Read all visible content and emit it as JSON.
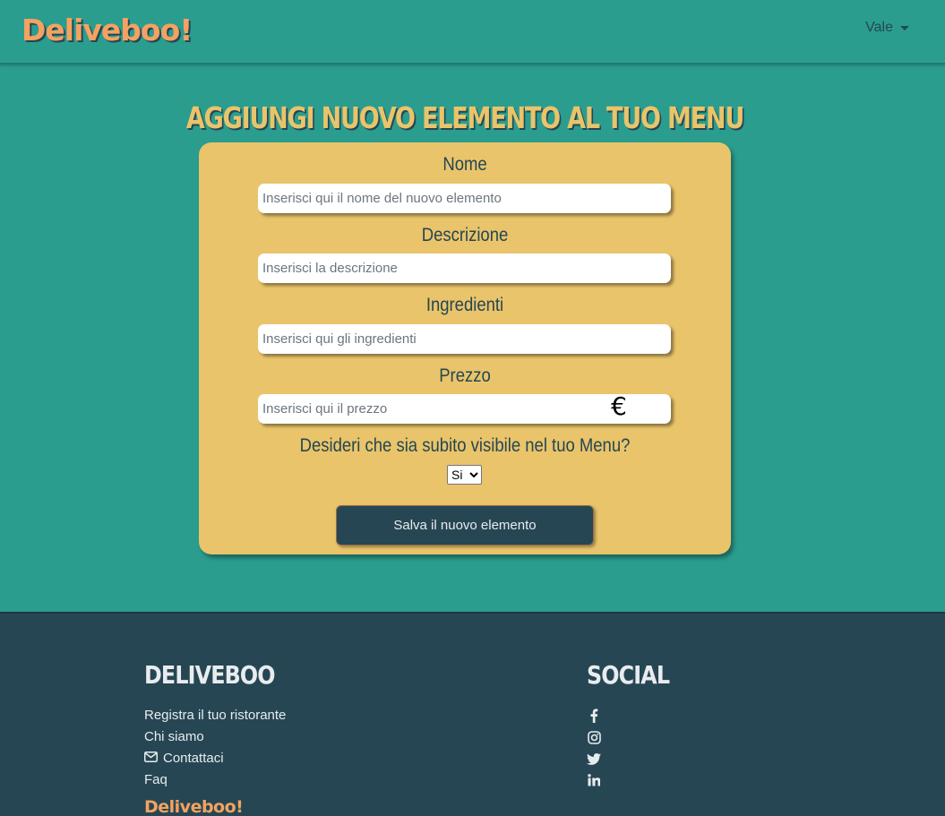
{
  "navbar": {
    "brand": "Deliveboo!",
    "user_name": "Vale"
  },
  "page": {
    "title": "AGGIUNGI NUOVO ELEMENTO AL TUO MENU"
  },
  "form": {
    "name": {
      "label": "Nome",
      "placeholder": "Inserisci qui il nome del nuovo elemento",
      "value": ""
    },
    "description": {
      "label": "Descrizione",
      "placeholder": "Inserisci la descrizione",
      "value": ""
    },
    "ingredients": {
      "label": "Ingredienti",
      "placeholder": "Inserisci qui gli ingredienti",
      "value": ""
    },
    "price": {
      "label": "Prezzo",
      "placeholder": "Inserisci qui il prezzo",
      "value": "",
      "currency_symbol": "€"
    },
    "visible": {
      "label": "Desideri che sia subito visibile nel tuo Menu?",
      "selected": "Si"
    },
    "submit_label": "Salva il nuovo elemento"
  },
  "footer": {
    "brand_heading": "DELIVEBOO",
    "links": [
      {
        "label": "Registra il tuo ristorante",
        "icon": null
      },
      {
        "label": "Chi siamo",
        "icon": null
      },
      {
        "label": "Contattaci",
        "icon": "envelope-icon"
      },
      {
        "label": "Faq",
        "icon": null
      }
    ],
    "logo": "Deliveboo!",
    "social_heading": "SOCIAL",
    "social_icons": [
      "facebook-icon",
      "instagram-icon",
      "twitter-icon",
      "linkedin-icon"
    ]
  },
  "colors": {
    "background": "#2a9d8f",
    "card": "#e9c46a",
    "dark": "#264653",
    "accent": "#f4a261"
  }
}
